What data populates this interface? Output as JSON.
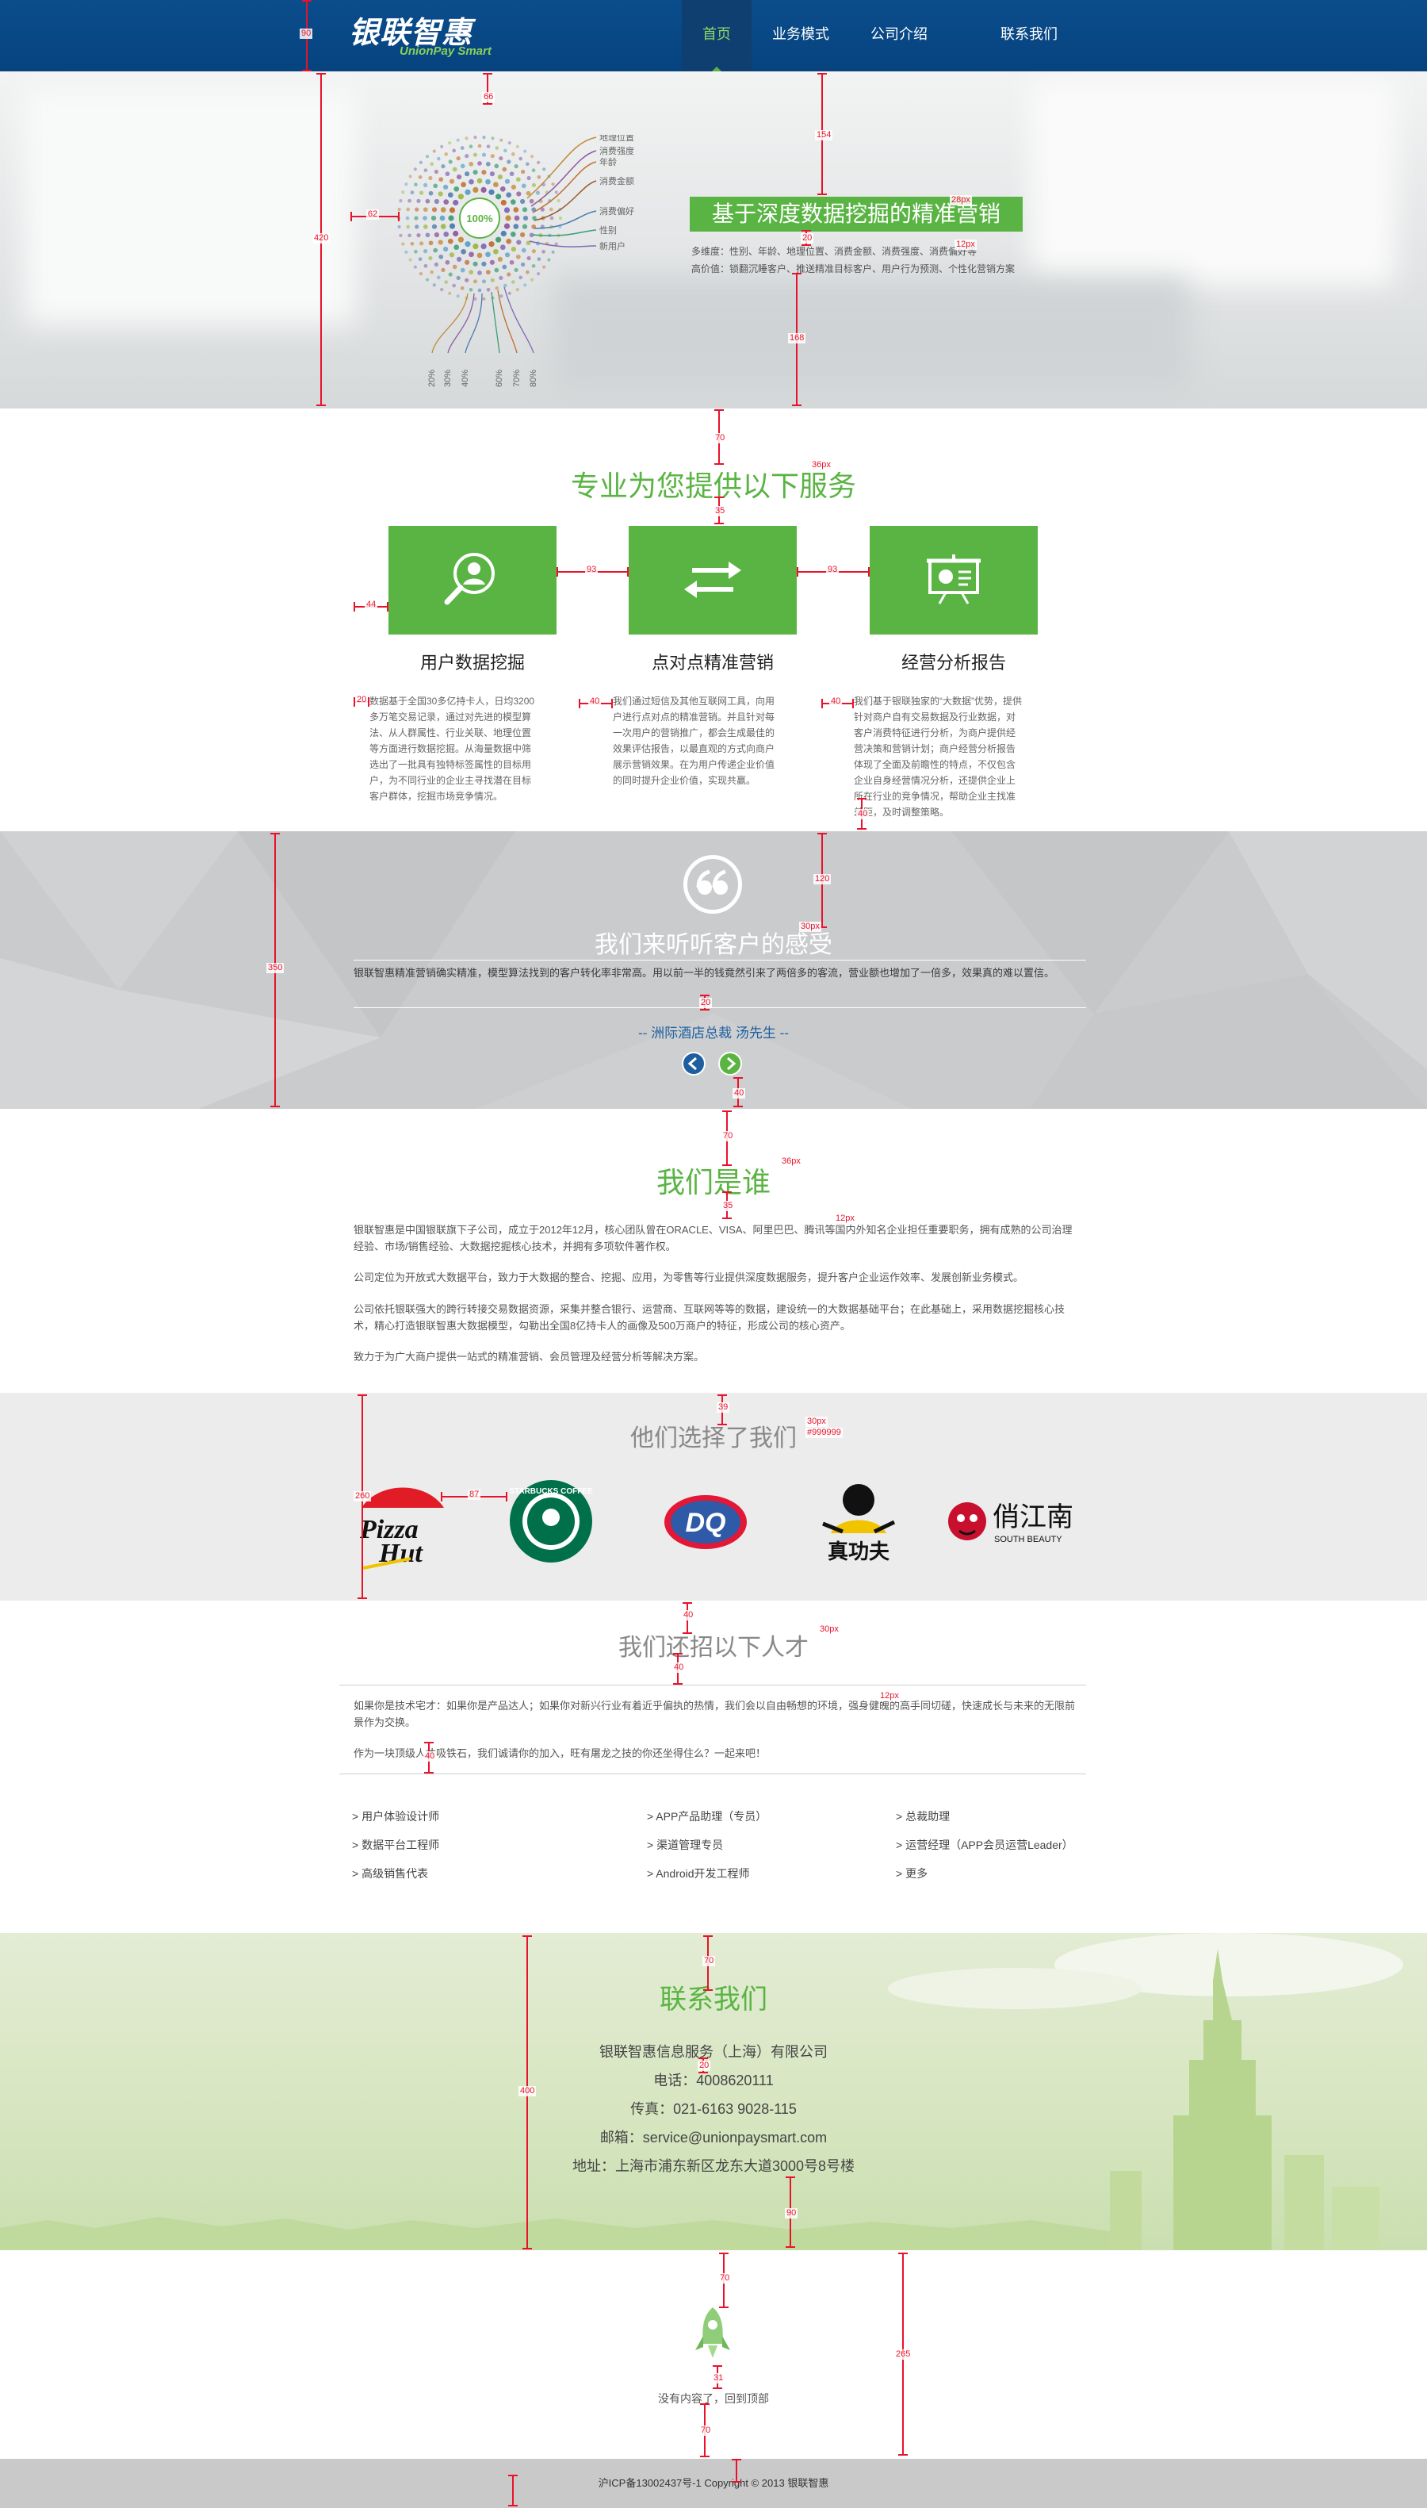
{
  "header": {
    "logo_cn": "银联智惠",
    "logo_en": "UnionPay Smart",
    "nav": [
      {
        "label": "首页",
        "active": true
      },
      {
        "label": "业务模式",
        "active": false
      },
      {
        "label": "公司介绍",
        "active": false
      },
      {
        "label": "联系我们",
        "active": false
      }
    ]
  },
  "hero": {
    "title": "基于深度数据挖掘的精准营销",
    "line1": "多维度：性别、年龄、地理位置、消费金额、消费强度、消费偏好等",
    "line2": "高价值：锁翻沉睡客户、推送精准目标客户、用户行为预测、个性化营销方案",
    "center_label": "100%",
    "callouts": [
      "地理位置",
      "消费强度",
      "年龄",
      "消费金额",
      "消费偏好",
      "性别",
      "新用户"
    ],
    "percent_labels": [
      "20%",
      "30%",
      "40%",
      "60%",
      "70%",
      "80%"
    ]
  },
  "services": {
    "title": "专业为您提供以下服务",
    "items": [
      {
        "name": "用户数据挖掘",
        "icon": "user-search-icon",
        "desc": "数据基于全国30多亿持卡人，日均3200多万笔交易记录，通过对先进的模型算法、从人群属性、行业关联、地理位置等方面进行数据挖掘。从海量数据中筛选出了一批具有独特标签属性的目标用户，为不同行业的企业主寻找潜在目标客户群体，挖掘市场竞争情况。"
      },
      {
        "name": "点对点精准营销",
        "icon": "exchange-icon",
        "desc": "我们通过短信及其他互联网工具，向用户进行点对点的精准营销。并且针对每一次用户的营销推广，都会生成最佳的效果评估报告，以最直观的方式向商户展示营销效果。在为用户传递企业价值的同时提升企业价值，实现共赢。"
      },
      {
        "name": "经营分析报告",
        "icon": "presentation-icon",
        "desc": "我们基于银联独家的“大数据”优势，提供针对商户自有交易数据及行业数据，对客户消费特征进行分析，为商户提供经营决策和营销计划；商户经营分析报告体现了全面及前瞻性的特点，不仅包含企业自身经营情况分析，还提供企业上所在行业的竞争情况，帮助企业主找准差距，及时调整策略。"
      }
    ]
  },
  "testimonial": {
    "title": "我们来听听客户的感受",
    "text": "银联智惠精准营销确实精准，模型算法找到的客户转化率非常高。用以前一半的钱竟然引来了两倍多的客流，营业额也增加了一倍多，效果真的难以置信。",
    "author": "-- 洲际酒店总裁 汤先生 --"
  },
  "about": {
    "title": "我们是谁",
    "paragraphs": [
      "银联智惠是中国银联旗下子公司，成立于2012年12月，核心团队曾在ORACLE、VISA、阿里巴巴、腾讯等国内外知名企业担任重要职务，拥有成熟的公司治理经验、市场/销售经验、大数据挖掘核心技术，并拥有多项软件著作权。",
      "公司定位为开放式大数据平台，致力于大数据的整合、挖掘、应用，为零售等行业提供深度数据服务，提升客户企业运作效率、发展创新业务模式。",
      "公司依托银联强大的跨行转接交易数据资源，采集并整合银行、运营商、互联网等等的数据，建设统一的大数据基础平台；在此基础上，采用数据挖掘核心技术，精心打造银联智惠大数据模型，勾勒出全国8亿持卡人的画像及500万商户的特征，形成公司的核心资产。",
      "致力于为广大商户提供一站式的精准营销、会员管理及经营分析等解决方案。"
    ]
  },
  "clients": {
    "title": "他们选择了我们",
    "logos": [
      {
        "name": "Pizza Hut",
        "line1": "Pizza",
        "line2": "Hut"
      },
      {
        "name": "Starbucks",
        "text": "STARBUCKS COFFEE"
      },
      {
        "name": "DQ",
        "text": "DQ"
      },
      {
        "name": "真功夫",
        "text": "真功夫"
      },
      {
        "name": "俏江南",
        "text": "俏江南",
        "sub": "SOUTH BEAUTY"
      }
    ]
  },
  "jobs": {
    "title": "我们还招以下人才",
    "intro1": "如果你是技术宅才：如果你是产品达人；如果你对新兴行业有着近乎偏执的热情，我们会以自由畅想的环境，强身健魄的高手同切磋，快速成长与未来的无限前景作为交换。",
    "intro2": "作为一块顶级人才吸铁石，我们诚请你的加入，旺有屠龙之技的你还坐得住么？一起来吧！",
    "positions": [
      "> 用户体验设计师",
      "> APP产品助理（专员）",
      "> 总裁助理",
      "> 数据平台工程师",
      "> 渠道管理专员",
      "> 运营经理（APP会员运营Leader）",
      "> 高级销售代表",
      "> Android开发工程师",
      "> 更多"
    ]
  },
  "contact": {
    "title": "联系我们",
    "company": "银联智惠信息服务（上海）有限公司",
    "phone": "电话：4008620111",
    "fax": "传真：021-6163 9028-115",
    "email": "邮箱：service@unionpaysmart.com",
    "address": "地址：上海市浦东新区龙东大道3000号8号楼"
  },
  "back_top": {
    "icon": "rocket-icon",
    "label": "没有内容了，回到顶部"
  },
  "footer": {
    "text": "沪ICP备13002437号-1 Copyright © 2013 银联智惠"
  },
  "annotations": {
    "a90": "90",
    "a66": "66",
    "a154": "154",
    "a20": "20",
    "a168": "168",
    "a420": "420",
    "a62": "62",
    "a28px": "28px",
    "a12px": "12px",
    "a70": "70",
    "a36px": "36px",
    "a35": "35",
    "a93": "93",
    "a44": "44",
    "a40": "40",
    "a120": "120",
    "a30px": "30px",
    "a350": "350",
    "a87": "87",
    "a39": "39",
    "a260": "a260",
    "a9999": "#999999",
    "a400": "400",
    "a265": "265",
    "a31": "31",
    "a16px": "16px"
  },
  "colors": {
    "brand_blue": "#0b4d8c",
    "brand_green": "#5ab443",
    "annotation_red": "#e8132b"
  }
}
